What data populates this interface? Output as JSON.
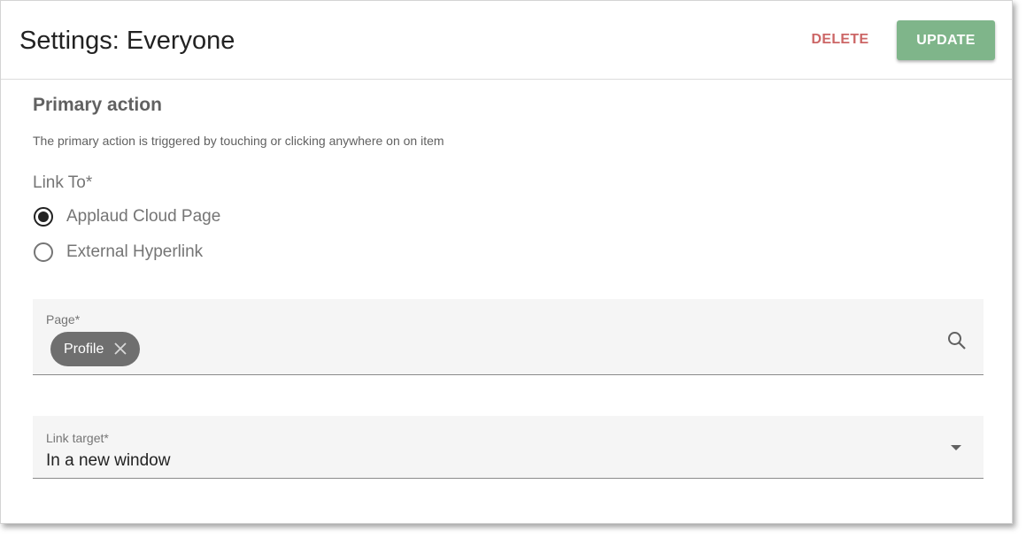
{
  "header": {
    "title": "Settings: Everyone",
    "delete_label": "DELETE",
    "update_label": "UPDATE"
  },
  "primary_action": {
    "title": "Primary action",
    "description": "The primary action is triggered by touching or clicking anywhere on on item",
    "link_to_label": "Link To*",
    "options": [
      {
        "label": "Applaud Cloud Page",
        "checked": true
      },
      {
        "label": "External Hyperlink",
        "checked": false
      }
    ]
  },
  "page_field": {
    "label": "Page*",
    "chip_label": "Profile",
    "icon": "search-icon"
  },
  "link_target_field": {
    "label": "Link target*",
    "value": "In a new window",
    "icon": "chevron-down-icon"
  },
  "colors": {
    "delete": "#cc6666",
    "update_bg": "#7fb58a",
    "field_bg": "#f5f5f5",
    "chip_bg": "#6f6f6f"
  }
}
